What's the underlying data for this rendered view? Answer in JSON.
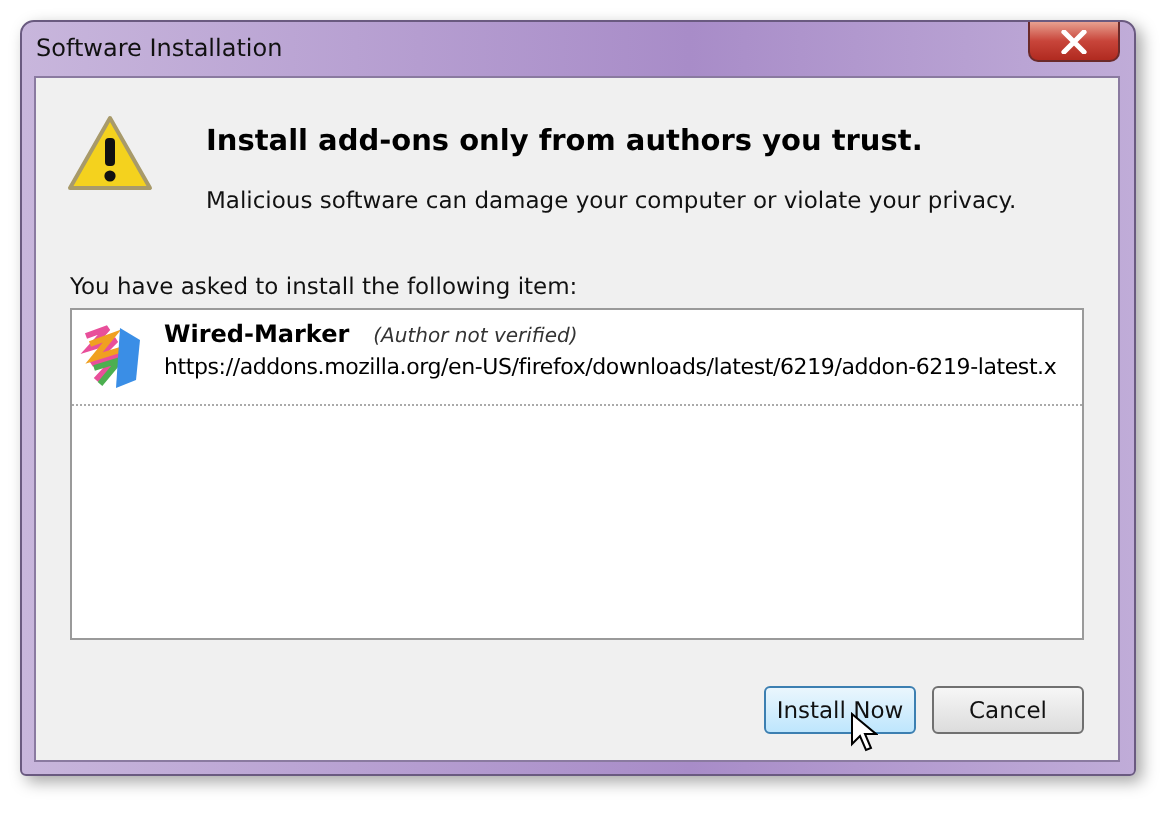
{
  "window": {
    "title": "Software Installation"
  },
  "heading": "Install add-ons only from authors you trust.",
  "warning": "Malicious software can damage your computer or violate your privacy.",
  "prompt": "You have asked to install the following item:",
  "items": [
    {
      "name": "Wired-Marker",
      "note": "(Author not verified)",
      "url": "https://addons.mozilla.org/en-US/firefox/downloads/latest/6219/addon-6219-latest.x"
    }
  ],
  "buttons": [
    {
      "label": "Install Now",
      "hovered": true
    },
    {
      "label": "Cancel",
      "hovered": false
    }
  ]
}
